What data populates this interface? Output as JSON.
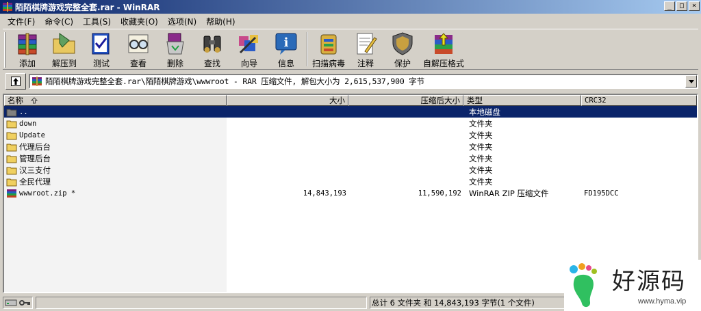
{
  "window": {
    "title": "陌陌棋牌游戏完整全套.rar - WinRAR",
    "controls": {
      "minimize": "_",
      "maximize": "□",
      "close": "×"
    }
  },
  "menu": [
    {
      "label": "文件(F)"
    },
    {
      "label": "命令(C)"
    },
    {
      "label": "工具(S)"
    },
    {
      "label": "收藏夹(O)"
    },
    {
      "label": "选项(N)"
    },
    {
      "label": "帮助(H)"
    }
  ],
  "toolbar": [
    {
      "label": "添加",
      "icon": "add-books-icon"
    },
    {
      "label": "解压到",
      "icon": "extract-folder-icon"
    },
    {
      "label": "测试",
      "icon": "test-check-icon"
    },
    {
      "label": "查看",
      "icon": "view-glasses-icon"
    },
    {
      "label": "删除",
      "icon": "delete-recycle-icon"
    },
    {
      "label": "查找",
      "icon": "find-binoculars-icon"
    },
    {
      "label": "向导",
      "icon": "wizard-icon"
    },
    {
      "label": "信息",
      "icon": "info-icon"
    },
    {
      "label": "扫描病毒",
      "icon": "virus-scan-icon"
    },
    {
      "label": "注释",
      "icon": "comment-icon"
    },
    {
      "label": "保护",
      "icon": "protect-shield-icon"
    },
    {
      "label": "自解压格式",
      "icon": "sfx-icon"
    }
  ],
  "address": {
    "path": "陌陌棋牌游戏完整全套.rar\\陌陌棋牌游戏\\wwwroot - RAR 压缩文件, 解包大小为 2,615,537,900 字节"
  },
  "columns": {
    "name": "名称",
    "size": "大小",
    "packed": "压缩后大小",
    "type": "类型",
    "crc": "CRC32"
  },
  "files": [
    {
      "name": "..",
      "size": "",
      "packed": "",
      "type": "本地磁盘",
      "crc": "",
      "icon": "parent-folder-icon",
      "selected": true
    },
    {
      "name": "down",
      "size": "",
      "packed": "",
      "type": "文件夹",
      "crc": "",
      "icon": "folder-icon"
    },
    {
      "name": "Update",
      "size": "",
      "packed": "",
      "type": "文件夹",
      "crc": "",
      "icon": "folder-icon"
    },
    {
      "name": "代理后台",
      "size": "",
      "packed": "",
      "type": "文件夹",
      "crc": "",
      "icon": "folder-icon"
    },
    {
      "name": "管理后台",
      "size": "",
      "packed": "",
      "type": "文件夹",
      "crc": "",
      "icon": "folder-icon"
    },
    {
      "name": "汉三支付",
      "size": "",
      "packed": "",
      "type": "文件夹",
      "crc": "",
      "icon": "folder-icon"
    },
    {
      "name": "全民代理",
      "size": "",
      "packed": "",
      "type": "文件夹",
      "crc": "",
      "icon": "folder-icon"
    },
    {
      "name": "wwwroot.zip *",
      "size": "14,843,193",
      "packed": "11,590,192",
      "type": "WinRAR ZIP 压缩文件",
      "crc": "FD195DCC",
      "icon": "zip-archive-icon"
    }
  ],
  "status": {
    "summary": "总计 6 文件夹 和 14,843,193 字节(1 个文件)"
  },
  "watermark": {
    "brand": "好源码",
    "url": "www.hyma.vip"
  },
  "colors": {
    "title_start": "#0a246a",
    "title_end": "#a6caf0",
    "selection": "#0a246a",
    "face": "#d4d0c8"
  }
}
